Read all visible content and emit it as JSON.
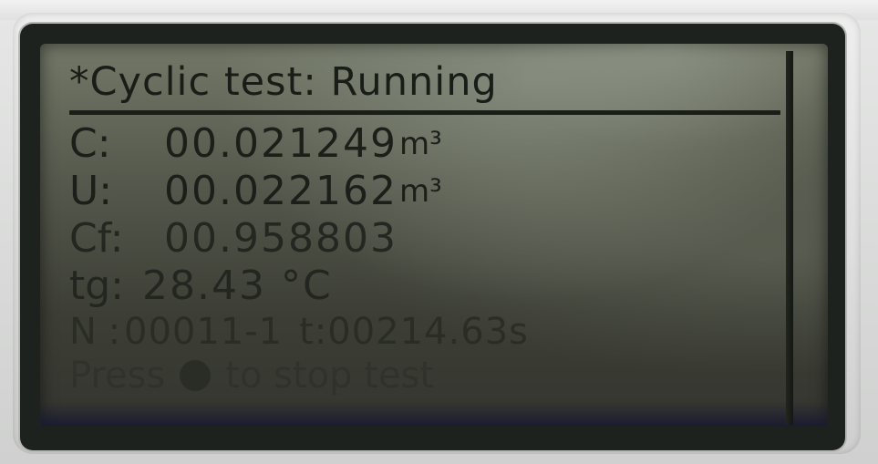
{
  "screen": {
    "title": "*Cyclic test: Running",
    "rows": [
      {
        "label": "C:",
        "value": "00.021249",
        "unit": "m³"
      },
      {
        "label": "U:",
        "value": "00.022162",
        "unit": "m³"
      },
      {
        "label": "Cf:",
        "value": "00.958803",
        "unit": ""
      },
      {
        "label": "tg:",
        "value": "28.43 °C",
        "unit": ""
      },
      {
        "label": "N :",
        "value": "00011-1",
        "time": "t:00214.63s"
      }
    ],
    "prompt_before": "Press",
    "prompt_after": "to stop test",
    "stop_icon": "filled-circle-icon"
  },
  "colors": {
    "lcd_background": "#56594d",
    "lcd_text": "#1c1e19",
    "bezel": "#dcdcdc"
  }
}
